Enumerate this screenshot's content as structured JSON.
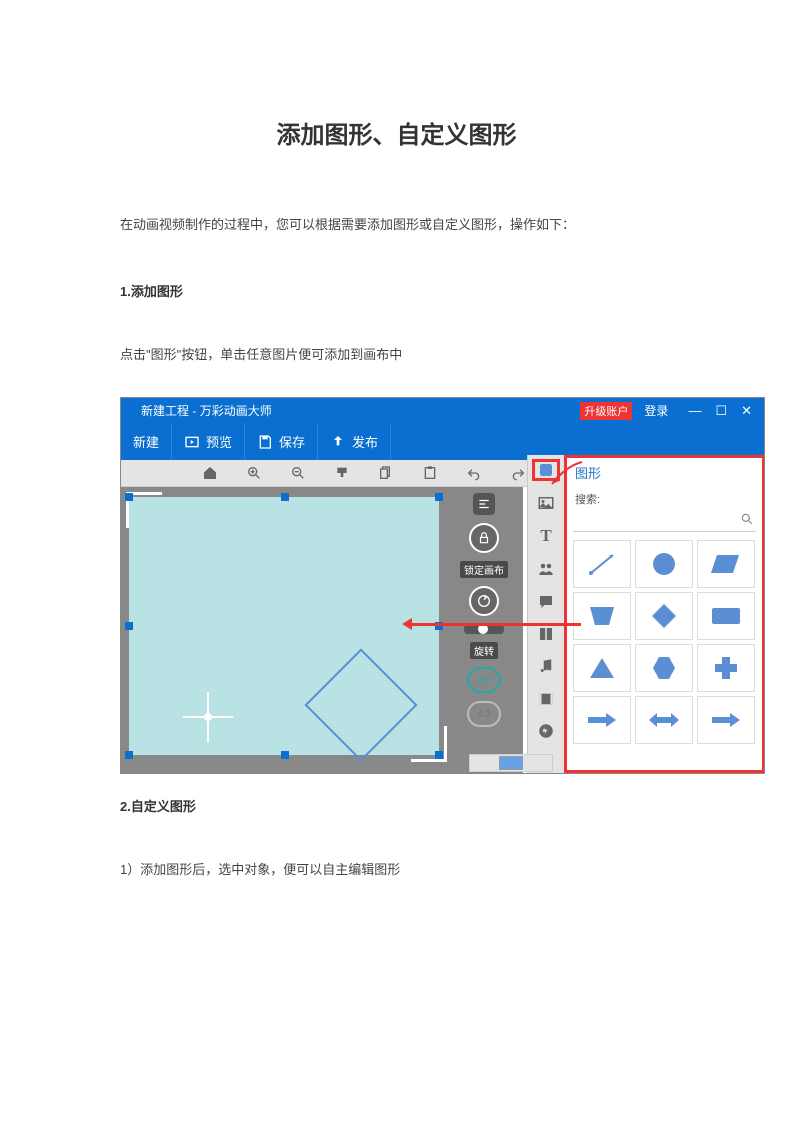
{
  "page": {
    "title": "添加图形、自定义图形",
    "intro": "在动画视频制作的过程中，您可以根据需要添加图形或自定义图形，操作如下：",
    "section1_heading": "1.添加图形",
    "section1_body": "点击\"图形\"按钮，单击任意图片便可添加到画布中",
    "section2_heading": "2.自定义图形",
    "section2_body": "1）添加图形后，选中对象，便可以自主编辑图形"
  },
  "app": {
    "titlebar": {
      "project": "新建工程",
      "appname": "万彩动画大师",
      "upgrade": "升级账户",
      "login": "登录"
    },
    "maintoolbar": {
      "newproj": "新建",
      "preview": "预览",
      "save": "保存",
      "publish": "发布"
    },
    "float": {
      "lock": "锁定画布",
      "rotate_value": "0",
      "rotate": "旋转",
      "ratio1": "16:9",
      "ratio2": "4:3"
    },
    "shapepanel": {
      "title": "图形",
      "search_label": "搜索:"
    },
    "shapes": [
      "line",
      "circle",
      "parallelogram",
      "trapezoid",
      "diamond",
      "rect",
      "triangle",
      "hexagon",
      "plus",
      "arrow-right",
      "arrow-lr",
      "arrow-right-2"
    ]
  }
}
